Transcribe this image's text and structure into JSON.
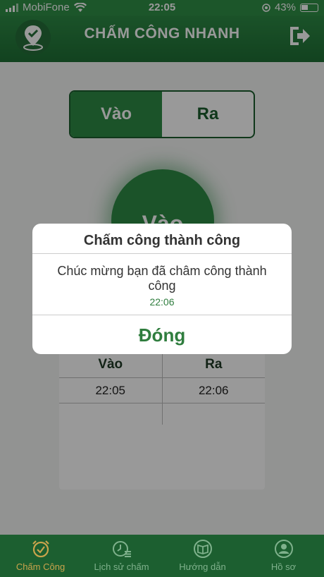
{
  "status_bar": {
    "carrier": "MobiFone",
    "time": "22:05",
    "battery": "43%"
  },
  "header": {
    "title": "CHẤM CÔNG NHANH"
  },
  "segment": {
    "in_label": "Vào",
    "out_label": "Ra",
    "selected": "in"
  },
  "check_button": {
    "label": "Vào"
  },
  "history": {
    "columns": [
      "Vào",
      "Ra"
    ],
    "rows": [
      {
        "in": "22:05",
        "out": "22:06"
      }
    ]
  },
  "dialog": {
    "title": "Chấm công thành công",
    "message": "Chúc mừng bạn đã châm công thành công",
    "time": "22:06",
    "close_label": "Đóng"
  },
  "tabbar": {
    "items": [
      {
        "label": "Chấm Công",
        "icon": "alarm-clock-icon",
        "active": true
      },
      {
        "label": "Lịch sử chấm",
        "icon": "history-icon",
        "active": false
      },
      {
        "label": "Hướng dẫn",
        "icon": "book-icon",
        "active": false
      },
      {
        "label": "Hồ sơ",
        "icon": "profile-icon",
        "active": false
      }
    ]
  },
  "colors": {
    "primary": "#2d8a45",
    "dark": "#1c5f30",
    "accent": "#c9a44c"
  }
}
